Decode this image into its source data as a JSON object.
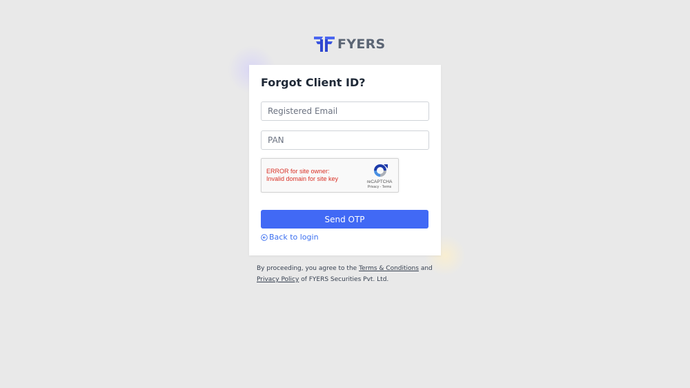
{
  "brand": {
    "name": "FYERS",
    "logo_icon": "fyers-logo-icon",
    "accent": "#4169f5"
  },
  "form": {
    "title": "Forgot Client ID?",
    "email_placeholder": "Registered Email",
    "email_value": "",
    "pan_placeholder": "PAN",
    "pan_value": "",
    "submit_label": "Send OTP",
    "back_label": "Back to login",
    "back_icon": "circle-arrow-left-icon"
  },
  "recaptcha": {
    "error_line1": "ERROR for site owner:",
    "error_line2": "Invalid domain for site key",
    "brand_label": "reCAPTCHA",
    "privacy_label": "Privacy",
    "separator": " - ",
    "terms_label": "Terms",
    "error_color": "#d93025"
  },
  "footer": {
    "prefix": "By proceeding, you agree to the ",
    "terms_link": "Terms & Conditions",
    "middle": " and ",
    "privacy_link": "Privacy Policy",
    "suffix": " of FYERS Securities Pvt. Ltd."
  }
}
